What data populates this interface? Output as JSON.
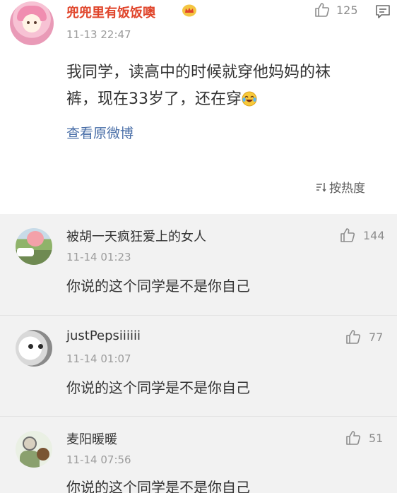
{
  "main_comment": {
    "username": "兜兜里有饭饭噢",
    "time": "11-13 22:47",
    "likes": "125",
    "content_line1": "我同学，读高中的时候就穿他妈妈的袜",
    "content_line2": "裤，现在33岁了，还在穿",
    "view_original": "查看原微博",
    "sort_label": "按热度",
    "icons": {
      "badge": "crown-badge-icon",
      "like": "thumbs-up-icon",
      "reply": "comment-icon",
      "emoji": "laughing-tears-emoji",
      "sort": "sort-icon"
    },
    "colors": {
      "username": "#e0442a",
      "link": "#4a6fa8"
    }
  },
  "replies": [
    {
      "username": "被胡一天疯狂爱上的女人",
      "time": "11-14 01:23",
      "likes": "144",
      "text": "你说的这个同学是不是你自己"
    },
    {
      "username": "justPepsiiiiii",
      "time": "11-14 01:07",
      "likes": "77",
      "text": "你说的这个同学是不是你自己"
    },
    {
      "username": "麦阳暖暖",
      "time": "11-14 07:56",
      "likes": "51",
      "text": "你说的这个同学是不是你自己"
    }
  ]
}
